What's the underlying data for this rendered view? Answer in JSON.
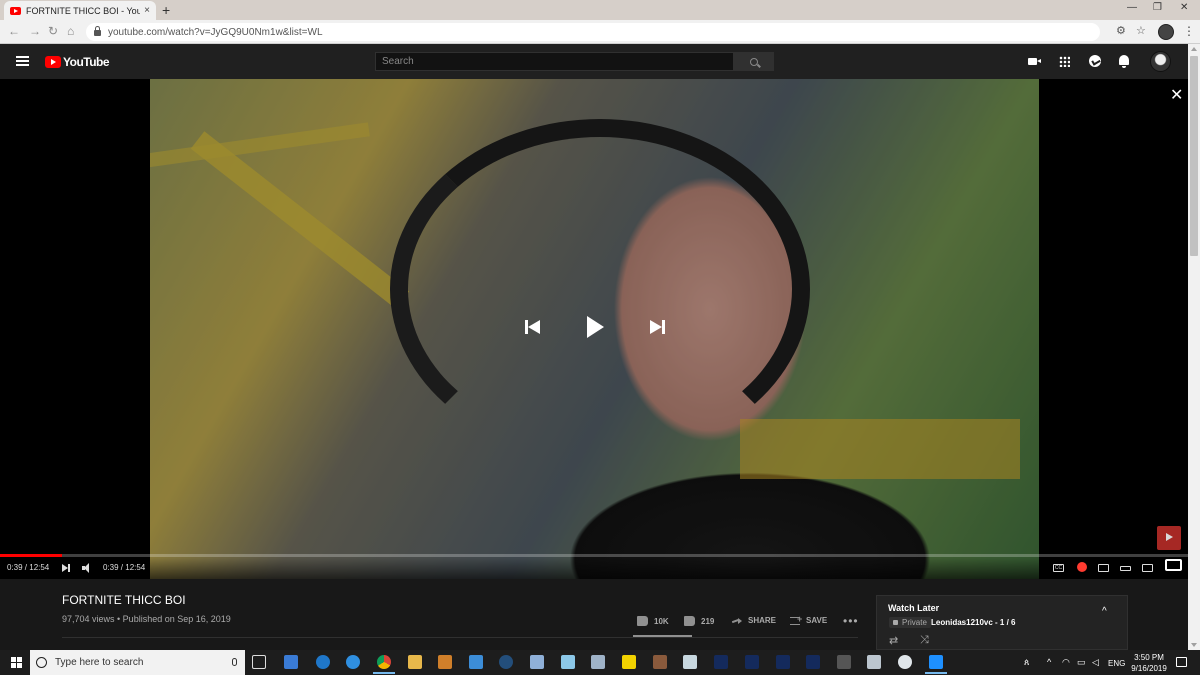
{
  "browser": {
    "tab_title": "FORTNITE THICC BOI - YouTube",
    "tab_close": "×",
    "new_tab": "+",
    "url": "youtube.com/watch?v=JyGQ9U0Nm1w&list=WL"
  },
  "masthead": {
    "logo_text": "YouTube",
    "search_placeholder": "Search"
  },
  "player": {
    "close_glyph": "✕",
    "progress_fraction": 0.052,
    "time_left": "0:39 / 12:54",
    "time_right": "0:39 / 12:54",
    "cc_label": "CC"
  },
  "video": {
    "title": "FORTNITE THICC BOI",
    "meta": "97,704 views • Published on Sep 16, 2019",
    "likes": "10K",
    "dislikes": "219",
    "share_label": "SHARE",
    "save_label": "SAVE",
    "more_glyph": "•••"
  },
  "playlist": {
    "title": "Watch Later",
    "privacy": "Private",
    "owner_position": "Leonidas1210vc - 1 / 6",
    "chevron": "^",
    "loop_glyph": "⇄",
    "shuffle_glyph": "⤨"
  },
  "taskbar": {
    "search_placeholder": "Type here to search",
    "language": "ENG",
    "time": "3:50 PM",
    "date": "9/16/2019"
  },
  "colors": {
    "youtube_red": "#ff0000",
    "masthead": "#202020",
    "page_bg": "#181818"
  }
}
